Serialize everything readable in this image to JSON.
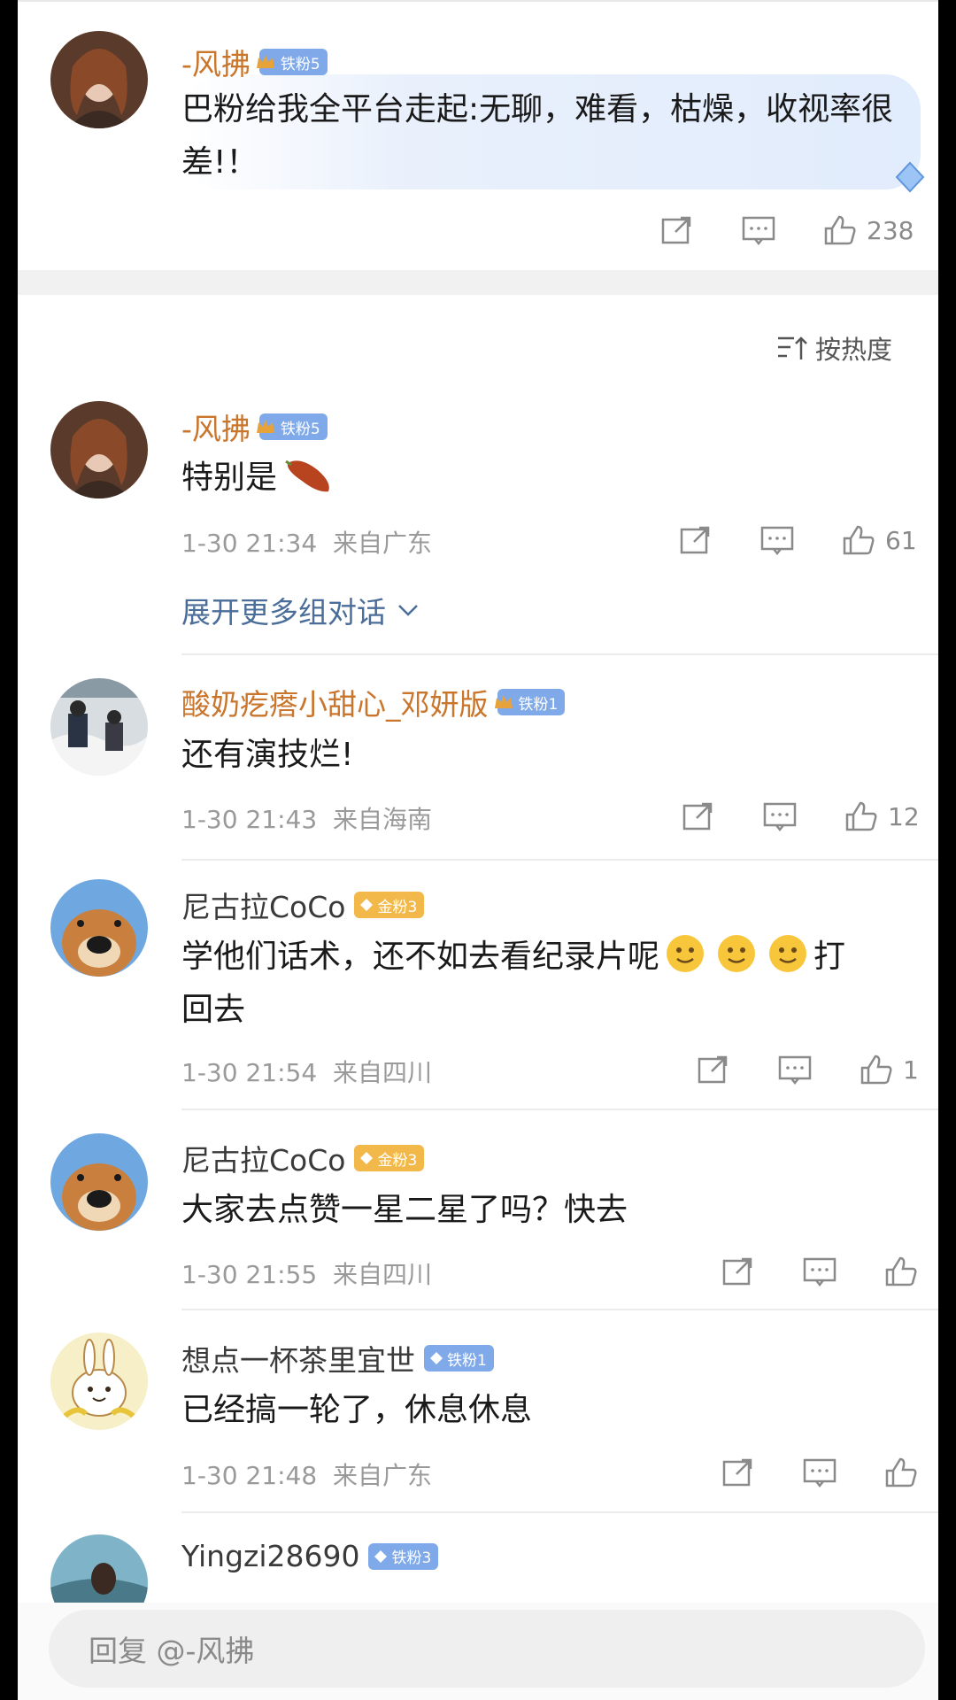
{
  "top_comment": {
    "user": "-风拂",
    "badge": "铁粉5",
    "text": "巴粉给我全平台走起:无聊，难看，枯燥，收视率很差!！",
    "likes": "238"
  },
  "sort_label": "按热度",
  "comments": [
    {
      "user": "-风拂",
      "badge": "铁粉5",
      "text": "特别是",
      "time": "1-30 21:34",
      "location": "来自广东",
      "likes": "61"
    },
    {
      "user": "酸奶疙瘩小甜心_邓妍版",
      "badge": "铁粉1",
      "text": "还有演技烂!",
      "time": "1-30 21:43",
      "location": "来自海南",
      "likes": "12"
    },
    {
      "user": "尼古拉CoCo",
      "badge": "金粉3",
      "text_a": "学他们话术，还不如去看纪录片呢",
      "text_b": "打",
      "text_c": "回去",
      "time": "1-30 21:54",
      "location": "来自四川",
      "likes": "1"
    },
    {
      "user": "尼古拉CoCo",
      "badge": "金粉3",
      "text": "大家去点赞一星二星了吗？快去",
      "time": "1-30 21:55",
      "location": "来自四川",
      "likes": ""
    },
    {
      "user": "想点一杯茶里宜世",
      "badge": "铁粉1",
      "text": "已经搞一轮了，休息休息",
      "time": "1-30 21:48",
      "location": "来自广东",
      "likes": ""
    },
    {
      "user": "Yingzi28690",
      "badge": "铁粉3"
    }
  ],
  "expand_label": "展开更多组对话",
  "reply_placeholder": "回复 @-风拂",
  "colors": {
    "username_orange": "#c9752c",
    "link_blue": "#4a6d9a",
    "meta_grey": "#9a9a9a"
  }
}
